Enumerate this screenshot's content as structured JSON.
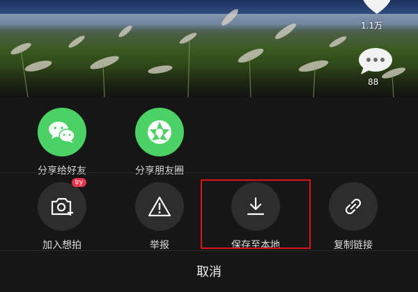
{
  "video": {
    "like_count": "1.1万",
    "comment_count": "88"
  },
  "share_row": [
    {
      "label": "分享给好友",
      "icon": "wechat-icon"
    },
    {
      "label": "分享朋友圈",
      "icon": "moments-shutter-icon"
    }
  ],
  "action_row": [
    {
      "label": "加入想拍",
      "icon": "camera-plus-icon",
      "badge": "try"
    },
    {
      "label": "举报",
      "icon": "warning-icon"
    },
    {
      "label": "保存至本地",
      "icon": "download-icon"
    },
    {
      "label": "复制链接",
      "icon": "link-icon"
    }
  ],
  "cancel_label": "取消",
  "colors": {
    "wechat_green": "#4ad264",
    "action_circle": "#2d2d2d",
    "sheet_bg": "#161616",
    "highlight": "#e3121a",
    "badge": "#e8344b"
  }
}
